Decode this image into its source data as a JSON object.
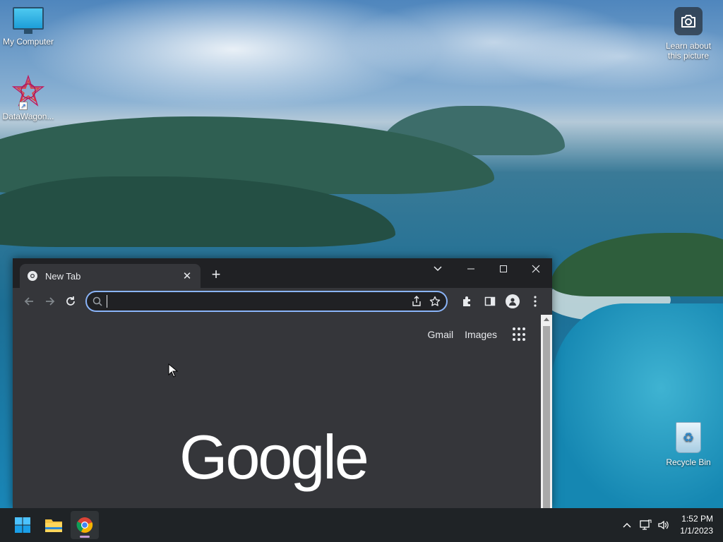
{
  "desktop": {
    "icons": [
      {
        "label": "My Computer"
      },
      {
        "label": "DataWagon..."
      },
      {
        "label": "Learn about this picture"
      },
      {
        "label": "Recycle Bin"
      }
    ]
  },
  "browser": {
    "tab": {
      "title": "New Tab"
    },
    "omnibox": {
      "value": "",
      "placeholder": ""
    },
    "page": {
      "links": {
        "gmail": "Gmail",
        "images": "Images"
      },
      "logo": "Google"
    }
  },
  "taskbar": {
    "clock": {
      "time": "1:52 PM",
      "date": "1/1/2023"
    }
  },
  "colors": {
    "chrome_dark": "#202124",
    "chrome_surface": "#35363a",
    "accent_blue": "#8ab4f8",
    "taskbar": "#1f2326"
  }
}
